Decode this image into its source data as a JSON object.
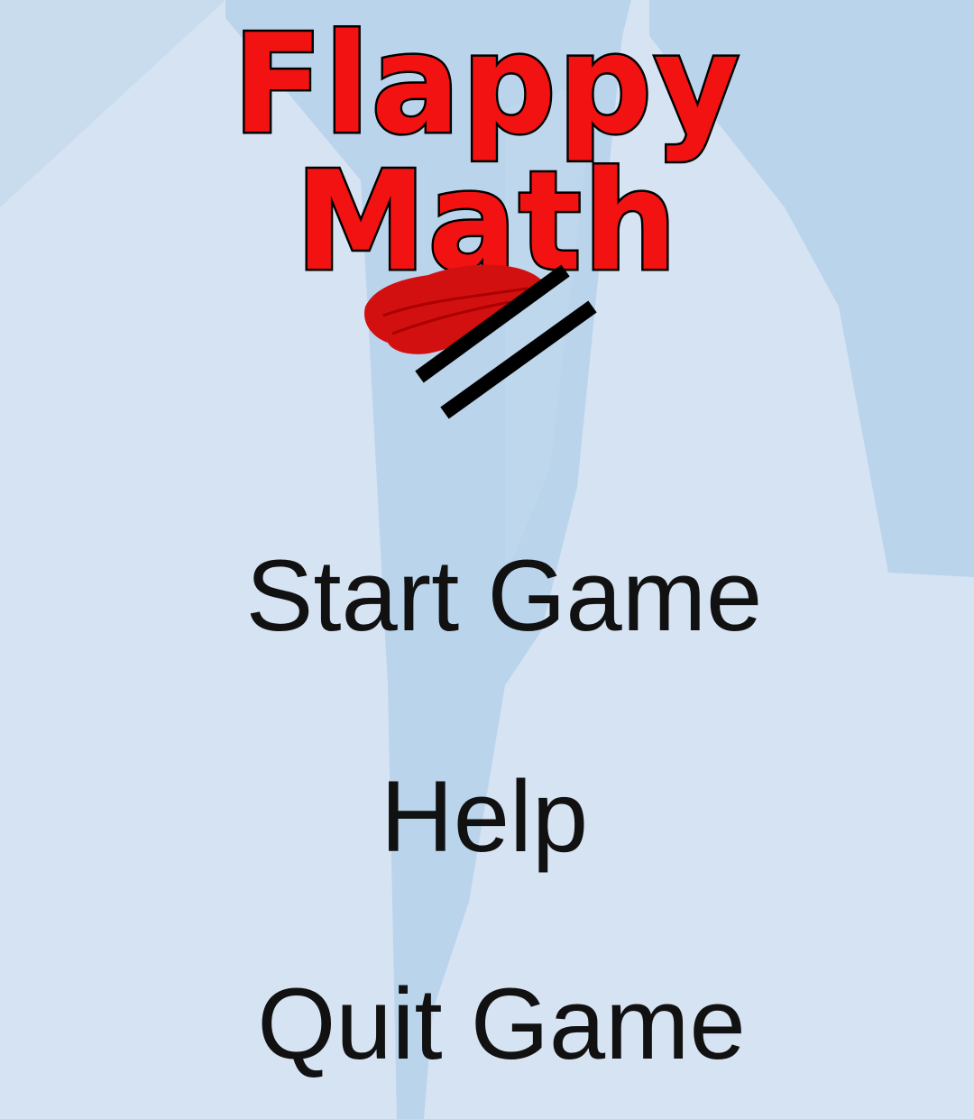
{
  "game": {
    "title": "Flappy Math",
    "logo_icon": "flying-equals-sign-icon",
    "colors": {
      "title_fill": "#f21212",
      "title_outline": "#000000",
      "background": "#d6e3f2",
      "pillar": "#bad4ec",
      "menu_text": "#111111"
    }
  },
  "menu": {
    "start_label": "Start Game",
    "help_label": "Help",
    "quit_label": "Quit Game"
  }
}
